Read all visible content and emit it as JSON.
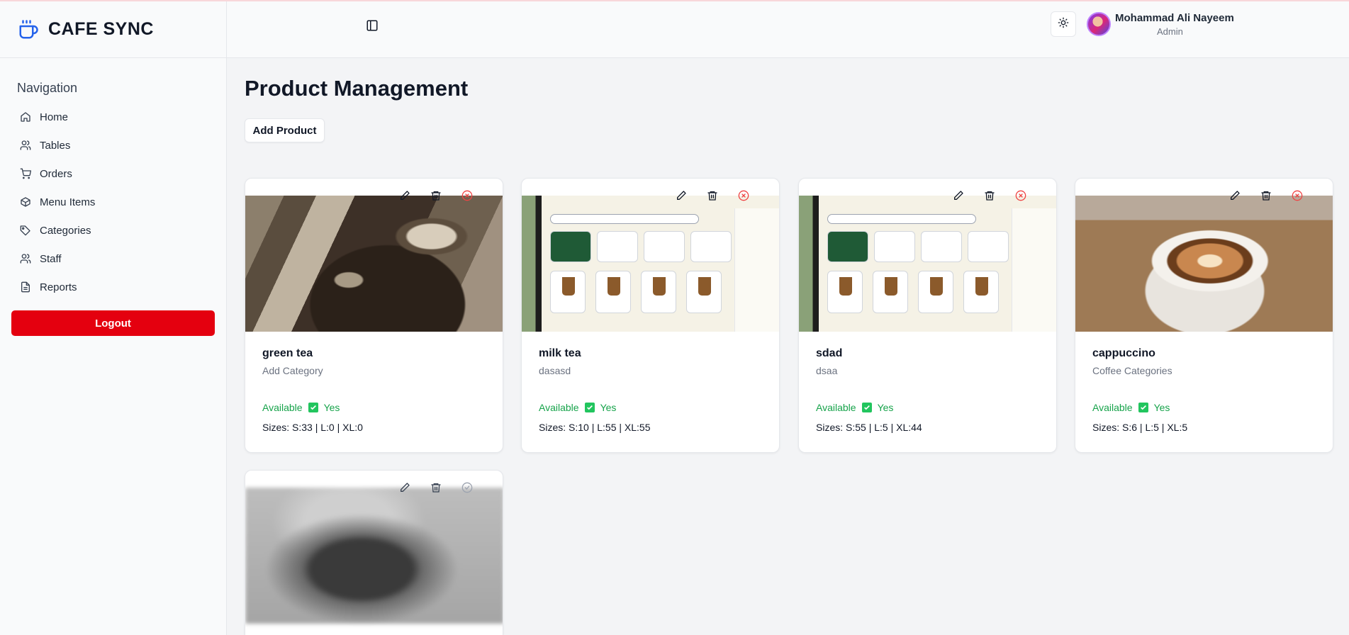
{
  "app": {
    "title": "CAFE SYNC"
  },
  "sidebar": {
    "heading": "Navigation",
    "items": [
      {
        "label": "Home",
        "icon": "home-icon"
      },
      {
        "label": "Tables",
        "icon": "users-icon"
      },
      {
        "label": "Orders",
        "icon": "cart-icon"
      },
      {
        "label": "Menu Items",
        "icon": "box-icon"
      },
      {
        "label": "Categories",
        "icon": "tag-icon"
      },
      {
        "label": "Staff",
        "icon": "users-icon"
      },
      {
        "label": "Reports",
        "icon": "file-icon"
      }
    ],
    "logout_label": "Logout"
  },
  "header": {
    "user_name": "Mohammad Ali Nayeem",
    "user_role": "Admin"
  },
  "main": {
    "title": "Product Management",
    "add_button_label": "Add Product",
    "products": [
      {
        "name": "green tea",
        "category": "Add Category",
        "available_label": "Available",
        "available_value": "Yes",
        "sizes": "Sizes: S:33 | L:0 | XL:0",
        "image": "vintage-car-photo",
        "status_icon": "x-circle-icon"
      },
      {
        "name": "milk tea",
        "category": "dasasd",
        "available_label": "Available",
        "available_value": "Yes",
        "sizes": "Sizes: S:10 | L:55 | XL:55",
        "image": "app-screenshot",
        "status_icon": "x-circle-icon"
      },
      {
        "name": "sdad",
        "category": "dsaa",
        "available_label": "Available",
        "available_value": "Yes",
        "sizes": "Sizes: S:55 | L:5 | XL:44",
        "image": "app-screenshot",
        "status_icon": "x-circle-icon"
      },
      {
        "name": "cappuccino",
        "category": "Coffee Categories",
        "available_label": "Available",
        "available_value": "Yes",
        "sizes": "Sizes: S:6 | L:5 | XL:5",
        "image": "latte-art-photo",
        "status_icon": "x-circle-icon"
      },
      {
        "name": "",
        "category": "",
        "image": "blurred-cup-photo",
        "status_icon": "check-circle-icon"
      }
    ]
  },
  "colors": {
    "accent": "#2563eb",
    "danger": "#e4000f",
    "success": "#16a34a"
  }
}
